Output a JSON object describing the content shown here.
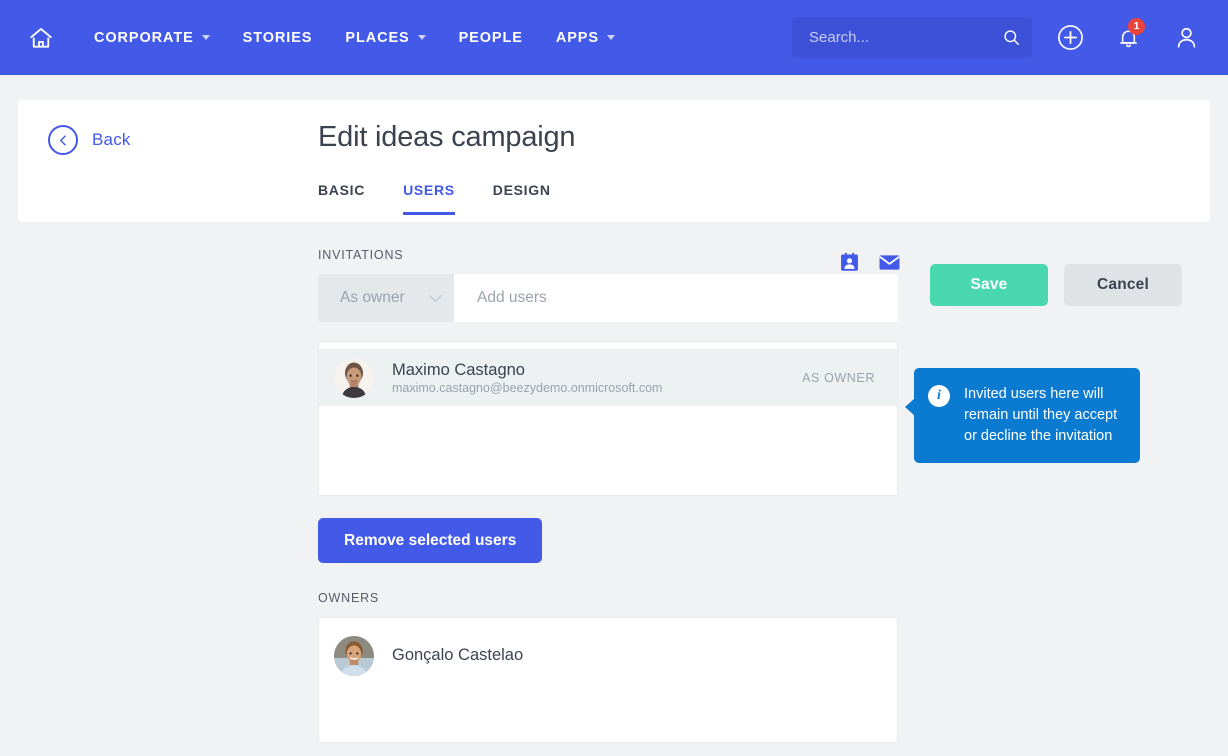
{
  "navbar": {
    "home_icon": "home-icon",
    "items": [
      {
        "label": "CORPORATE",
        "has_caret": true
      },
      {
        "label": "STORIES",
        "has_caret": false
      },
      {
        "label": "PLACES",
        "has_caret": true
      },
      {
        "label": "PEOPLE",
        "has_caret": false
      },
      {
        "label": "APPS",
        "has_caret": true
      }
    ],
    "search": {
      "placeholder": "Search...",
      "value": "",
      "icon": "search-icon"
    },
    "add_icon": "plus-circle-icon",
    "notifications": {
      "icon": "bell-icon",
      "badge_count": "1"
    },
    "profile_icon": "user-icon",
    "bg_color": "#4359e8",
    "badge_color": "#e8443b"
  },
  "header": {
    "back_label": "Back",
    "back_icon": "chevron-left-circle-icon",
    "title": "Edit ideas campaign",
    "tabs": [
      {
        "label": "BASIC",
        "active": false
      },
      {
        "label": "USERS",
        "active": true
      },
      {
        "label": "DESIGN",
        "active": false
      }
    ],
    "save_label": "Save",
    "cancel_label": "Cancel",
    "save_color": "#4ad8b1",
    "cancel_color": "#dfe3e6",
    "accent_color": "#4359e8"
  },
  "invitations": {
    "section_label": "INVITATIONS",
    "contact_icon": "contact-card-icon",
    "mail_icon": "envelope-icon",
    "role_select": {
      "value": "As owner",
      "icon": "chevron-down-icon"
    },
    "add_users_input": {
      "placeholder": "Add users",
      "value": ""
    },
    "users": [
      {
        "name": "Maximo Castagno",
        "email": "maximo.castagno@beezydemo.onmicrosoft.com",
        "role": "AS OWNER",
        "selected": true
      }
    ],
    "remove_button_label": "Remove selected users"
  },
  "tooltip": {
    "icon": "info-icon",
    "text": "Invited users here will remain until they accept or decline the invitation",
    "bg_color": "#0a7bd1"
  },
  "owners": {
    "section_label": "OWNERS",
    "users": [
      {
        "name": "Gonçalo Castelao"
      }
    ]
  }
}
